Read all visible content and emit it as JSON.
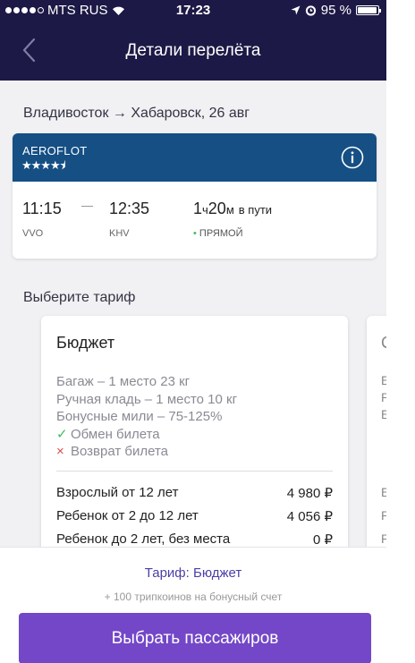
{
  "status_bar": {
    "carrier": "MTS RUS",
    "time": "17:23",
    "battery_text": "95 %",
    "battery_level": 0.95
  },
  "nav": {
    "title": "Детали перелёта",
    "back_icon": "chevron-left-icon"
  },
  "route": {
    "title": "Владивосток → Хабаровск, 26 авг"
  },
  "flight": {
    "airline": "AEROFLOT",
    "stars": "★★★★⯨",
    "rating": 4.5,
    "departure_time": "11:15",
    "arrival_time": "12:35",
    "departure_code": "VVO",
    "arrival_code": "KHV",
    "duration_hours": "1",
    "duration_h_unit": "ч",
    "duration_minutes": "20",
    "duration_m_unit": "м",
    "duration_suffix": "в пути",
    "stops_label": "ПРЯМОЙ"
  },
  "tariffs": {
    "section_label": "Выберите тариф",
    "selected": {
      "name": "Бюджет",
      "features": {
        "baggage": "Багаж – 1 место 23 кг",
        "hand_luggage": "Ручная кладь – 1 место 10 кг",
        "bonus_miles": "Бонусные мили – 75-125%",
        "exchange": "Обмен билета",
        "refund": "Возврат билета"
      },
      "prices": [
        {
          "label": "Взрослый от 12 лет",
          "value": "4 980 ₽"
        },
        {
          "label": "Ребенок от 2 до 12 лет",
          "value": "4 056 ₽"
        },
        {
          "label": "Ребенок до 2 лет, без места",
          "value": "0 ₽"
        }
      ]
    },
    "next_card_partial": [
      "С",
      "Б",
      "Р",
      "Б",
      "Б",
      "Р",
      "Р"
    ]
  },
  "bottom": {
    "selected_tariff": "Тариф: Бюджет",
    "bonus": "+ 100  трипкоинов на бонусный счет",
    "button_label": "Выбрать пассажиров"
  },
  "colors": {
    "header": "#1c1946",
    "airline_band": "#154f84",
    "button": "#7347c7",
    "accent_text": "#4b3ea8",
    "check": "#3cbf5a",
    "cross": "#e04a4a"
  }
}
